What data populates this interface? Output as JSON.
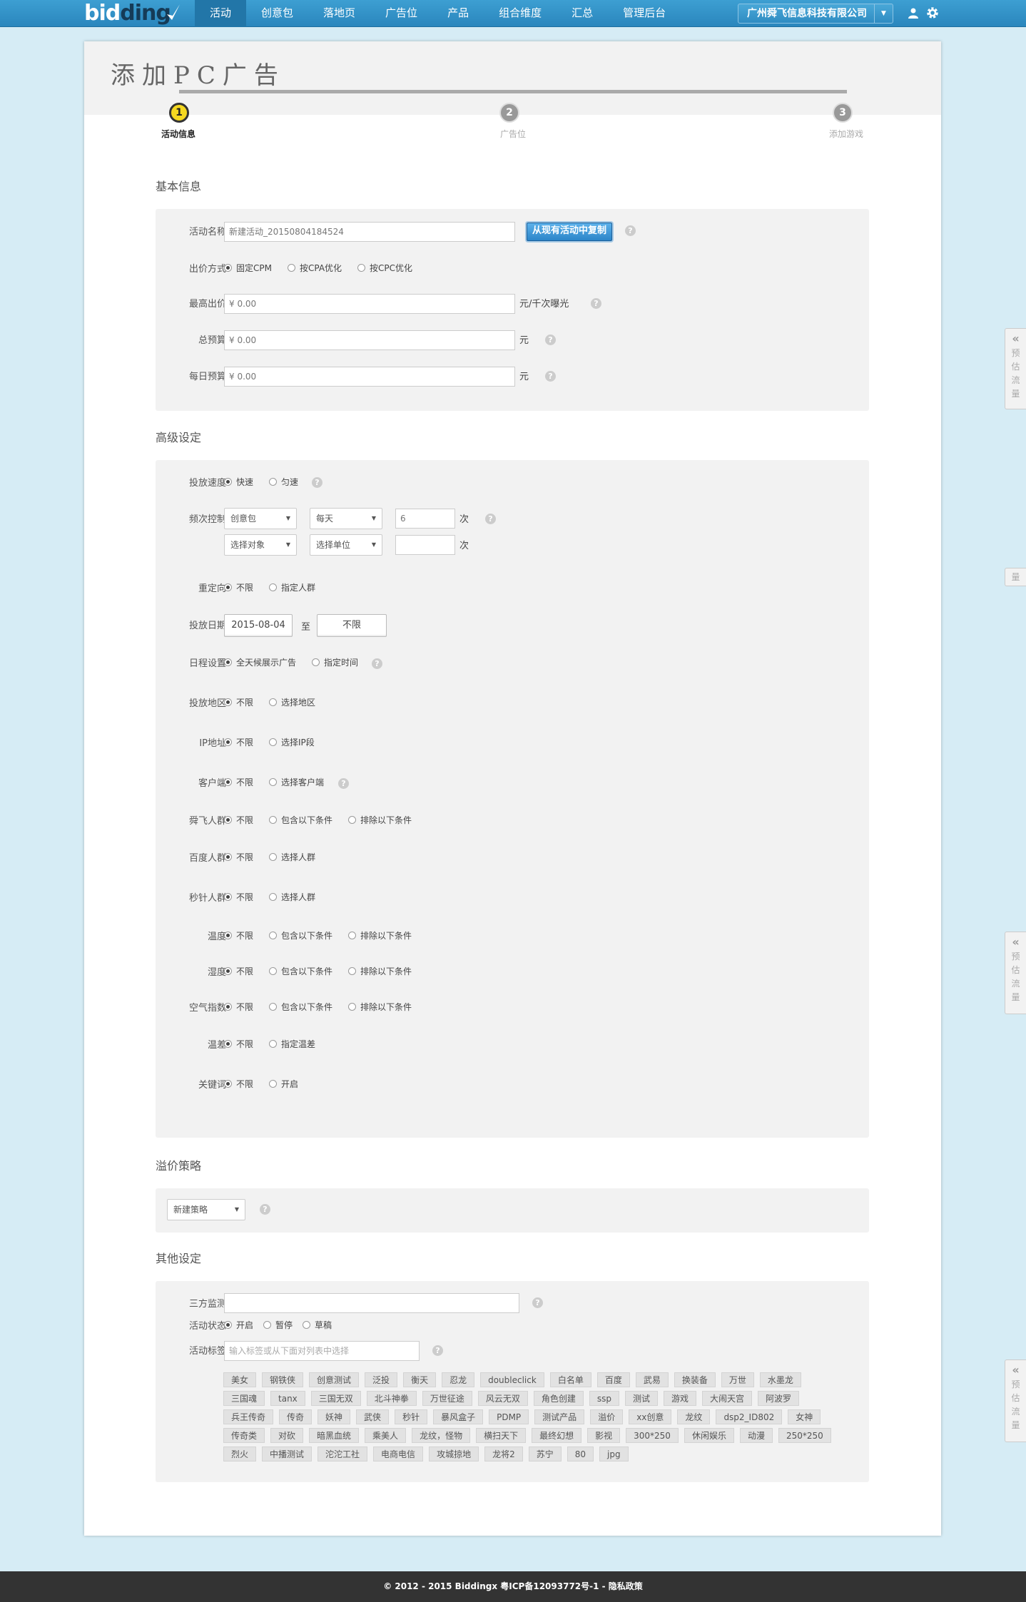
{
  "brand": {
    "logo_part1": "bid",
    "logo_part2": "ding"
  },
  "nav": [
    "活动",
    "创意包",
    "落地页",
    "广告位",
    "产品",
    "组合维度",
    "汇总",
    "管理后台"
  ],
  "company": "广州舜飞信息科技有限公司",
  "page_title": "添加PC广告",
  "steps": [
    {
      "num": "1",
      "label": "活动信息"
    },
    {
      "num": "2",
      "label": "广告位"
    },
    {
      "num": "3",
      "label": "添加游戏"
    }
  ],
  "sections": {
    "basic": "基本信息",
    "advanced": "高级设定",
    "premium": "溢价策略",
    "other": "其他设定"
  },
  "basic": {
    "name_label": "活动名称：",
    "name_value": "新建活动_20150804184524",
    "copy_button": "从现有活动中复制",
    "bid_label": "出价方式：",
    "bid_options": [
      "固定CPM",
      "按CPA优化",
      "按CPC优化"
    ],
    "max_bid_label": "最高出价：",
    "max_bid_value": "0.00",
    "max_bid_unit": "元/千次曝光",
    "total_label": "总预算：",
    "total_value": "0.00",
    "total_unit": "元",
    "daily_label": "每日预算：",
    "daily_value": "0.00",
    "daily_unit": "元",
    "currency": "¥"
  },
  "advanced": {
    "speed_label": "投放速度：",
    "speed_options": [
      "快速",
      "匀速"
    ],
    "freq_label": "频次控制：",
    "freq_sel1": "创意包",
    "freq_sel2": "每天",
    "freq_value": "6",
    "freq_unit": "次",
    "freq_sel3": "选择对象",
    "freq_sel4": "选择单位",
    "freq_value2": "",
    "freq_unit2": "次",
    "retarget_label": "重定向：",
    "retarget_options": [
      "不限",
      "指定人群"
    ],
    "date_label": "投放日期：",
    "date_start": "2015-08-04",
    "date_to": "至",
    "date_end": "不限",
    "schedule_label": "日程设置：",
    "schedule_options": [
      "全天候展示广告",
      "指定时间"
    ],
    "region_label": "投放地区：",
    "region_options": [
      "不限",
      "选择地区"
    ],
    "ip_label": "IP地址：",
    "ip_options": [
      "不限",
      "选择IP段"
    ],
    "client_label": "客户端：",
    "client_options": [
      "不限",
      "选择客户端"
    ],
    "sf_label": "舜飞人群：",
    "sf_options": [
      "不限",
      "包含以下条件",
      "排除以下条件"
    ],
    "baidu_label": "百度人群：",
    "baidu_options": [
      "不限",
      "选择人群"
    ],
    "mz_label": "秒针人群：",
    "mz_options": [
      "不限",
      "选择人群"
    ],
    "temp_label": "温度：",
    "temp_options": [
      "不限",
      "包含以下条件",
      "排除以下条件"
    ],
    "humid_label": "湿度：",
    "humid_options": [
      "不限",
      "包含以下条件",
      "排除以下条件"
    ],
    "air_label": "空气指数：",
    "air_options": [
      "不限",
      "包含以下条件",
      "排除以下条件"
    ],
    "tdiff_label": "温差：",
    "tdiff_options": [
      "不限",
      "指定温差"
    ],
    "kw_label": "关键词：",
    "kw_options": [
      "不限",
      "开启"
    ]
  },
  "premium": {
    "select": "新建策略"
  },
  "other": {
    "monitor_label": "三方监测：",
    "monitor_value": "",
    "status_label": "活动状态：",
    "status_options": [
      "开启",
      "暂停",
      "草稿"
    ],
    "tags_label": "活动标签：",
    "tags_placeholder": "输入标签或从下面对列表中选择",
    "tags": [
      "美女",
      "钢铁侠",
      "创意测试",
      "泛投",
      "衡天",
      "忍龙",
      "doubleclick",
      "白名单",
      "百度",
      "武易",
      "换装备",
      "万世",
      "水墨龙",
      "三国魂",
      "tanx",
      "三国无双",
      "北斗神拳",
      "万世征途",
      "风云无双",
      "角色创建",
      "ssp",
      "测试",
      "游戏",
      "大闹天宫",
      "阿波罗",
      "兵王传奇",
      "传奇",
      "妖神",
      "武侠",
      "秒针",
      "暴风盒子",
      "PDMP",
      "测试产品",
      "溢价",
      "xx创意",
      "龙纹",
      "dsp2_ID802",
      "女神",
      "传奇类",
      "对砍",
      "暗黑血统",
      "乘美人",
      "龙纹，怪物",
      "横扫天下",
      "最终幻想",
      "影视",
      "300*250",
      "休闲娱乐",
      "动漫",
      "250*250",
      "烈火",
      "中播测试",
      "沱沱工社",
      "电商电信",
      "攻城掠地",
      "龙将2",
      "苏宁",
      "80",
      "jpg"
    ]
  },
  "sidebar": {
    "arrow": "«",
    "label": [
      "预",
      "估",
      "流",
      "量"
    ],
    "mid": "量"
  },
  "help_glyph": "?",
  "footer": "© 2012 - 2015 Biddingx 粤ICP备12093772号-1 - 隐私政策"
}
